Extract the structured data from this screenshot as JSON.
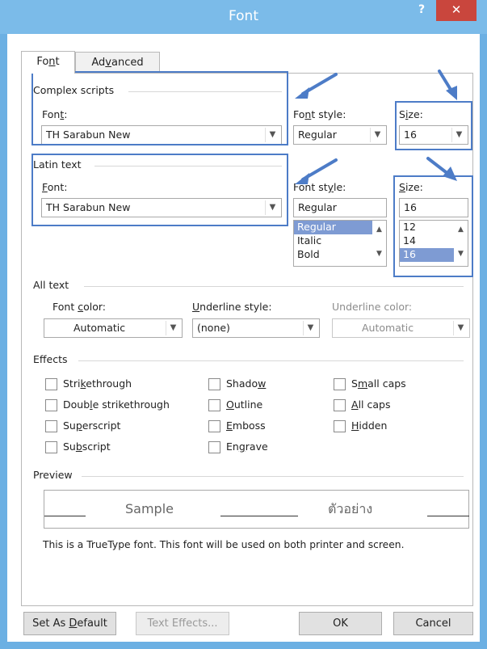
{
  "window": {
    "title": "Font",
    "help_label": "?",
    "close_label": "✕"
  },
  "tabs": [
    {
      "label_pre": "Fo",
      "label_key": "n",
      "label_post": "t",
      "active": true
    },
    {
      "label_pre": "Ad",
      "label_key": "v",
      "label_post": "anced",
      "active": false
    }
  ],
  "complex_scripts": {
    "group_label": "Complex scripts",
    "font_label_pre": "Fon",
    "font_label_key": "t",
    "font_label_post": ":",
    "font_value": "TH Sarabun New",
    "style_label_pre": "Fo",
    "style_label_key": "n",
    "style_label_post": "t style:",
    "style_value": "Regular",
    "size_label_pre": "S",
    "size_label_key": "i",
    "size_label_post": "ze:",
    "size_value": "16"
  },
  "latin_text": {
    "group_label": "Latin text",
    "font_label_pre": "",
    "font_label_key": "F",
    "font_label_post": "ont:",
    "font_value": "TH Sarabun New",
    "style_label_pre": "Font st",
    "style_label_key": "y",
    "style_label_post": "le:",
    "style_value": "Regular",
    "style_options": [
      "Regular",
      "Italic",
      "Bold"
    ],
    "style_selected": "Regular",
    "size_label_pre": "",
    "size_label_key": "S",
    "size_label_post": "ize:",
    "size_value": "16",
    "size_options": [
      "12",
      "14",
      "16"
    ],
    "size_selected": "16"
  },
  "all_text": {
    "group_label": "All text",
    "color_label_pre": "Font ",
    "color_label_key": "c",
    "color_label_post": "olor:",
    "color_value": "Automatic",
    "underline_label_pre": "",
    "underline_label_key": "U",
    "underline_label_post": "nderline style:",
    "underline_value": "(none)",
    "underline_color_label": "Underline color:",
    "underline_color_value": "Automatic"
  },
  "effects": {
    "group_label": "Effects",
    "items": [
      {
        "pre": "Stri",
        "key": "k",
        "post": "ethrough",
        "checked": false
      },
      {
        "pre": "Doub",
        "key": "l",
        "post": "e strikethrough",
        "checked": false
      },
      {
        "pre": "Su",
        "key": "p",
        "post": "erscript",
        "checked": false
      },
      {
        "pre": "Su",
        "key": "b",
        "post": "script",
        "checked": false
      },
      {
        "pre": "Shado",
        "key": "w",
        "post": "",
        "checked": false
      },
      {
        "pre": "",
        "key": "O",
        "post": "utline",
        "checked": false
      },
      {
        "pre": "",
        "key": "E",
        "post": "mboss",
        "checked": false
      },
      {
        "pre": "En",
        "key": "g",
        "post": "rave",
        "checked": false
      },
      {
        "pre": "S",
        "key": "m",
        "post": "all caps",
        "checked": false
      },
      {
        "pre": "",
        "key": "A",
        "post": "ll caps",
        "checked": false
      },
      {
        "pre": "",
        "key": "H",
        "post": "idden",
        "checked": false
      }
    ]
  },
  "preview": {
    "group_label": "Preview",
    "sample_latin": "Sample",
    "sample_thai": "ตัวอย่าง",
    "note": "This is a TrueType font. This font will be used on both printer and screen."
  },
  "buttons": {
    "set_default_pre": "Set As ",
    "set_default_key": "D",
    "set_default_post": "efault",
    "text_effects": "Text Effects...",
    "ok": "OK",
    "cancel": "Cancel"
  },
  "annotation_colors": {
    "box": "#4d7cc7",
    "arrow": "#4d7cc7"
  }
}
